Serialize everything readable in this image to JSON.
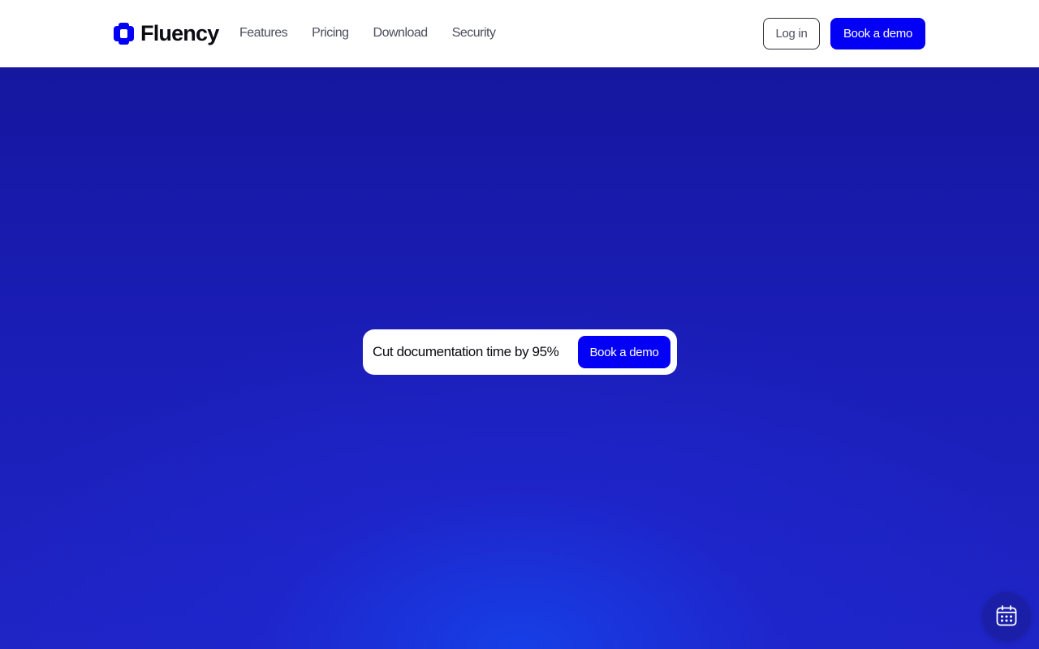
{
  "brand": {
    "name": "Fluency",
    "accent": "#0400f5"
  },
  "nav": {
    "links": [
      {
        "label": "Features"
      },
      {
        "label": "Pricing"
      },
      {
        "label": "Download"
      },
      {
        "label": "Security"
      }
    ],
    "login_label": "Log in",
    "demo_label": "Book a demo"
  },
  "hero": {
    "headline": "Cut documentation time by 95%",
    "cta_label": "Book a demo",
    "background_top": "#15179f",
    "background_glow": "#1640e8"
  },
  "floating": {
    "icon": "calendar-icon"
  }
}
